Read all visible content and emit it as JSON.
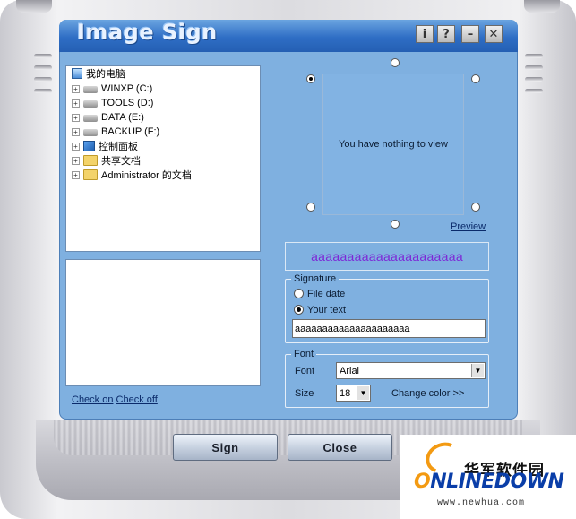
{
  "app": {
    "title": "Image Sign"
  },
  "titlebar_buttons": {
    "info": "i",
    "help": "?",
    "minimize": "–",
    "close": "✕"
  },
  "tree": {
    "items": [
      {
        "label": "我的电脑",
        "icon": "computer-icon"
      },
      {
        "label": "WINXP (C:)",
        "icon": "drive-icon"
      },
      {
        "label": "TOOLS (D:)",
        "icon": "drive-icon"
      },
      {
        "label": "DATA (E:)",
        "icon": "drive-icon"
      },
      {
        "label": "BACKUP (F:)",
        "icon": "drive-icon"
      },
      {
        "label": "控制面板",
        "icon": "control-panel-icon"
      },
      {
        "label": "共享文档",
        "icon": "folder-icon"
      },
      {
        "label": "Administrator 的文档",
        "icon": "folder-icon"
      }
    ],
    "expander": "+"
  },
  "links": {
    "check_on": "Check on",
    "check_off": "Check off"
  },
  "preview": {
    "empty_text": "You have nothing to view",
    "link": "Preview",
    "selected_position": "top-left"
  },
  "sample_text": "aaaaaaaaaaaaaaaaaaaaa",
  "signature": {
    "legend": "Signature",
    "option_file_date": "File date",
    "option_your_text": "Your text",
    "selected": "Your text",
    "text_value": "aaaaaaaaaaaaaaaaaaaaa"
  },
  "font": {
    "legend": "Font",
    "font_label": "Font",
    "font_value": "Arial",
    "size_label": "Size",
    "size_value": "18",
    "change_color": "Change color >>"
  },
  "actions": {
    "sign": "Sign",
    "close": "Close"
  },
  "watermark": {
    "cn": "华军软件园",
    "brand_o": "O",
    "brand_rest": "NLINEDOWN",
    "url": "www.newhua.com"
  },
  "colors": {
    "panel": "#7fb0e0",
    "titlebar": "#2f6ec5",
    "sample_text": "#7d28d6",
    "logo_blue": "#0a3ea8",
    "logo_orange": "#f39a12"
  }
}
